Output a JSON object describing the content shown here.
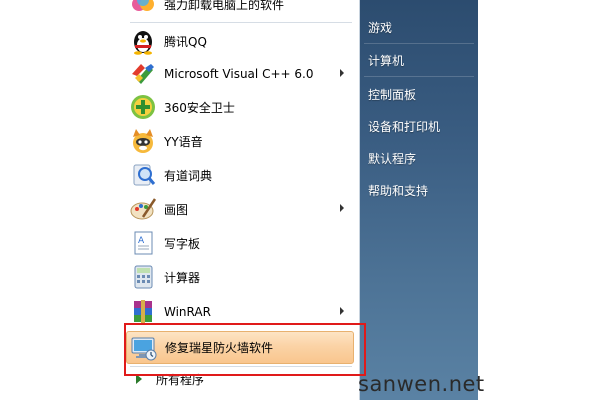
{
  "programs": [
    {
      "label": "强力卸载电脑上的软件",
      "icon": "uninstall-icon",
      "has_submenu": false
    },
    {
      "label": "腾讯QQ",
      "icon": "qq-penguin-icon",
      "has_submenu": false
    },
    {
      "label": "Microsoft Visual C++ 6.0",
      "icon": "visual-cpp-icon",
      "has_submenu": true
    },
    {
      "label": "360安全卫士",
      "icon": "360-guard-icon",
      "has_submenu": false
    },
    {
      "label": "YY语音",
      "icon": "yy-voice-icon",
      "has_submenu": false
    },
    {
      "label": "有道词典",
      "icon": "youdao-dict-icon",
      "has_submenu": false
    },
    {
      "label": "画图",
      "icon": "paint-icon",
      "has_submenu": true
    },
    {
      "label": "写字板",
      "icon": "wordpad-icon",
      "has_submenu": false
    },
    {
      "label": "计算器",
      "icon": "calculator-icon",
      "has_submenu": false
    },
    {
      "label": "WinRAR",
      "icon": "winrar-icon",
      "has_submenu": true
    },
    {
      "label": "修复瑞星防火墙软件",
      "icon": "computer-repair-icon",
      "has_submenu": false,
      "highlighted": true
    }
  ],
  "all_programs_label": "所有程序",
  "right_pane": {
    "items": [
      "游戏",
      "计算机",
      "控制面板",
      "设备和打印机",
      "默认程序",
      "帮助和支持"
    ]
  },
  "watermark": "sanwen.net",
  "colors": {
    "highlight": "#fbd3a6",
    "annotation_box": "#e01a1a",
    "right_pane": "#3a5d82"
  }
}
